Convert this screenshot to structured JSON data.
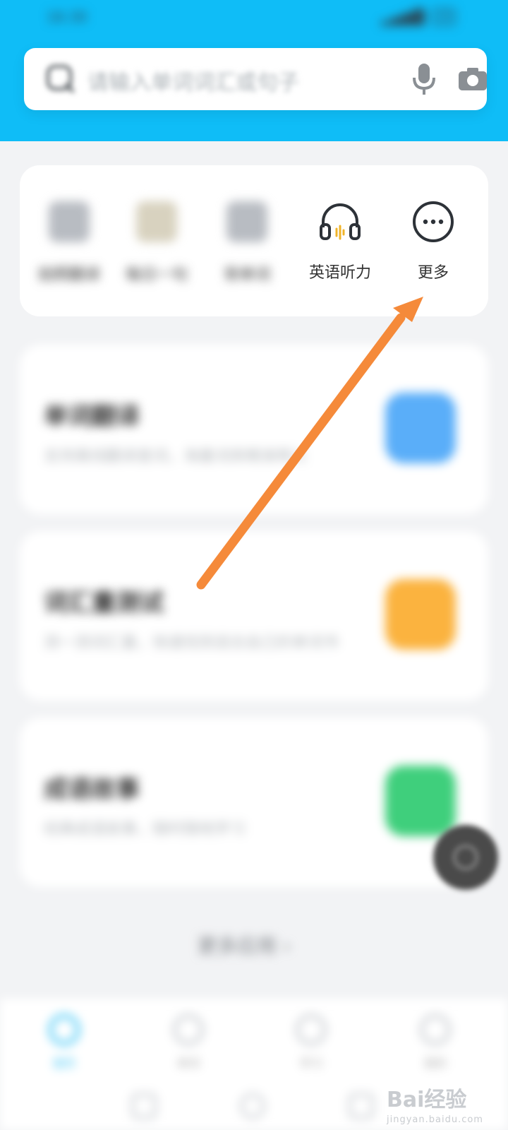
{
  "status_bar": {
    "time": "16:30",
    "battery": "28"
  },
  "search": {
    "placeholder": "请输入单词词汇或句子"
  },
  "shortcuts": [
    {
      "label": "拍照翻译",
      "blurred": true
    },
    {
      "label": "每日一句",
      "blurred": true
    },
    {
      "label": "背单词",
      "blurred": true
    },
    {
      "label": "英语听力",
      "blurred": false
    },
    {
      "label": "更多",
      "blurred": false
    }
  ],
  "features": [
    {
      "title": "单词翻译",
      "subtitle": "支持离线翻译查词，海量词库精准释义",
      "color": "#5aaef9"
    },
    {
      "title": "词汇量测试",
      "subtitle": "测一测词汇量，快速找到适合自己的单词书",
      "color": "#fbb33f"
    },
    {
      "title": "成语故事",
      "subtitle": "经典成语故事，随时随地学习",
      "color": "#3fcf7c"
    }
  ],
  "more_apps": "更多应用 ›",
  "bottom_nav": [
    {
      "label": "首页",
      "active": true
    },
    {
      "label": "单词",
      "active": false
    },
    {
      "label": "学习",
      "active": false
    },
    {
      "label": "我的",
      "active": false
    }
  ],
  "colors": {
    "header": "#0fbdf7",
    "arrow": "#f58a3a",
    "accent": "#33c2f5"
  },
  "watermark": {
    "brand": "Bai经验",
    "site": "jingyan.baidu.com"
  }
}
